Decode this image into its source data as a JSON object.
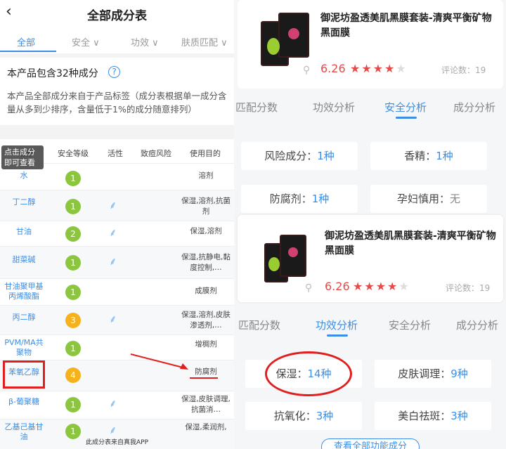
{
  "left": {
    "back_icon": "chevron-left-icon",
    "title": "全部成分表",
    "tabs": [
      {
        "label": "全部"
      },
      {
        "label": "安全"
      },
      {
        "label": "功效"
      },
      {
        "label": "肤质匹配"
      }
    ],
    "summary": "本产品包含32种成分",
    "note": "本产品全部成分来自于产品标签（成分表根据单一成分含量从多到少排序，含量低于1%的成分随意排列）",
    "tooltip": "点击成分即可查看",
    "headers": {
      "name": "成分",
      "safety": "安全等级",
      "active": "活性",
      "acne": "致痘风险",
      "purpose": "使用目的"
    },
    "rows": [
      {
        "name": "水",
        "level": "1",
        "purpose": "溶剂"
      },
      {
        "name": "丁二醇",
        "level": "1",
        "purpose": "保湿,溶剂,抗菌剂"
      },
      {
        "name": "甘油",
        "level": "2",
        "purpose": "保湿,溶剂"
      },
      {
        "name": "甜菜碱",
        "level": "1",
        "purpose": "保湿,抗静电,黏度控制,…"
      },
      {
        "name": "甘油聚甲基丙烯酸酯",
        "level": "1",
        "purpose": "成膜剂"
      },
      {
        "name": "丙二醇",
        "level": "3",
        "purpose": "保湿,溶剂,皮肤渗透剂,…"
      },
      {
        "name": "PVM/MA共聚物",
        "level": "1",
        "purpose": "增稠剂"
      },
      {
        "name": "苯氧乙醇",
        "level": "4",
        "purpose": "防腐剂"
      },
      {
        "name": "β-葡聚糖",
        "level": "1",
        "purpose": "保湿,皮肤调理,抗菌消…"
      },
      {
        "name": "乙基己基甘油",
        "level": "1",
        "purpose": "保湿,柔润剂,"
      }
    ],
    "footer": "此成分表来自真我APP",
    "colors": {
      "accent": "#3a8ee6",
      "level1": "#8cc63f",
      "level2": "#8cc63f",
      "level3": "#f5b21c",
      "level4": "#f5b21c",
      "highlight": "#e02020"
    }
  },
  "right": {
    "product": {
      "title": "御泥坊盈透美肌黑膜套装-清爽平衡矿物黑面膜",
      "score": "6.26",
      "rating_stars": 4,
      "reviews": "评论数：19"
    },
    "tabs": [
      {
        "label": "匹配分数"
      },
      {
        "label": "功效分析"
      },
      {
        "label": "安全分析"
      },
      {
        "label": "成分分析"
      }
    ],
    "safety_stats": [
      {
        "label": "风险成分：",
        "value": "1种"
      },
      {
        "label": "香精：",
        "value": "1种"
      },
      {
        "label": "防腐剂：",
        "value": "1种"
      },
      {
        "label": "孕妇慎用：",
        "value": "无"
      }
    ],
    "efficacy_stats": [
      {
        "label": "保湿：",
        "value": "14种"
      },
      {
        "label": "皮肤调理：",
        "value": "9种"
      },
      {
        "label": "抗氧化：",
        "value": "3种"
      },
      {
        "label": "美白祛斑：",
        "value": "3种"
      }
    ],
    "view_all": "查看全部功能成分"
  }
}
